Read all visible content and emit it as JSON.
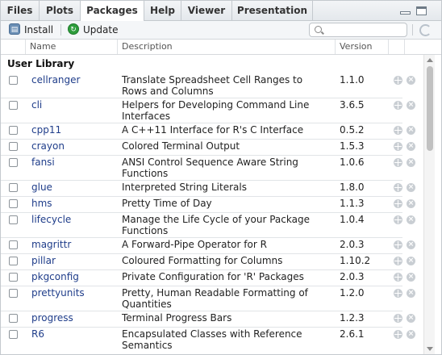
{
  "tabs": [
    {
      "label": "Files",
      "active": false
    },
    {
      "label": "Plots",
      "active": false
    },
    {
      "label": "Packages",
      "active": true
    },
    {
      "label": "Help",
      "active": false
    },
    {
      "label": "Viewer",
      "active": false
    },
    {
      "label": "Presentation",
      "active": false
    }
  ],
  "toolbar": {
    "install_label": "Install",
    "update_label": "Update",
    "search_placeholder": ""
  },
  "columns": {
    "name": "Name",
    "description": "Description",
    "version": "Version"
  },
  "section_title": "User Library",
  "packages": [
    {
      "name": "cellranger",
      "description": "Translate Spreadsheet Cell Ranges to Rows and Columns",
      "version": "1.1.0"
    },
    {
      "name": "cli",
      "description": "Helpers for Developing Command Line Interfaces",
      "version": "3.6.5"
    },
    {
      "name": "cpp11",
      "description": "A C++11 Interface for R's C Interface",
      "version": "0.5.2"
    },
    {
      "name": "crayon",
      "description": "Colored Terminal Output",
      "version": "1.5.3"
    },
    {
      "name": "fansi",
      "description": "ANSI Control Sequence Aware String Functions",
      "version": "1.0.6"
    },
    {
      "name": "glue",
      "description": "Interpreted String Literals",
      "version": "1.8.0"
    },
    {
      "name": "hms",
      "description": "Pretty Time of Day",
      "version": "1.1.3"
    },
    {
      "name": "lifecycle",
      "description": "Manage the Life Cycle of your Package Functions",
      "version": "1.0.4"
    },
    {
      "name": "magrittr",
      "description": "A Forward-Pipe Operator for R",
      "version": "2.0.3"
    },
    {
      "name": "pillar",
      "description": "Coloured Formatting for Columns",
      "version": "1.10.2"
    },
    {
      "name": "pkgconfig",
      "description": "Private Configuration for 'R' Packages",
      "version": "2.0.3"
    },
    {
      "name": "prettyunits",
      "description": "Pretty, Human Readable Formatting of Quantities",
      "version": "1.2.0"
    },
    {
      "name": "progress",
      "description": "Terminal Progress Bars",
      "version": "1.2.3"
    },
    {
      "name": "R6",
      "description": "Encapsulated Classes with Reference Semantics",
      "version": "2.6.1"
    }
  ]
}
